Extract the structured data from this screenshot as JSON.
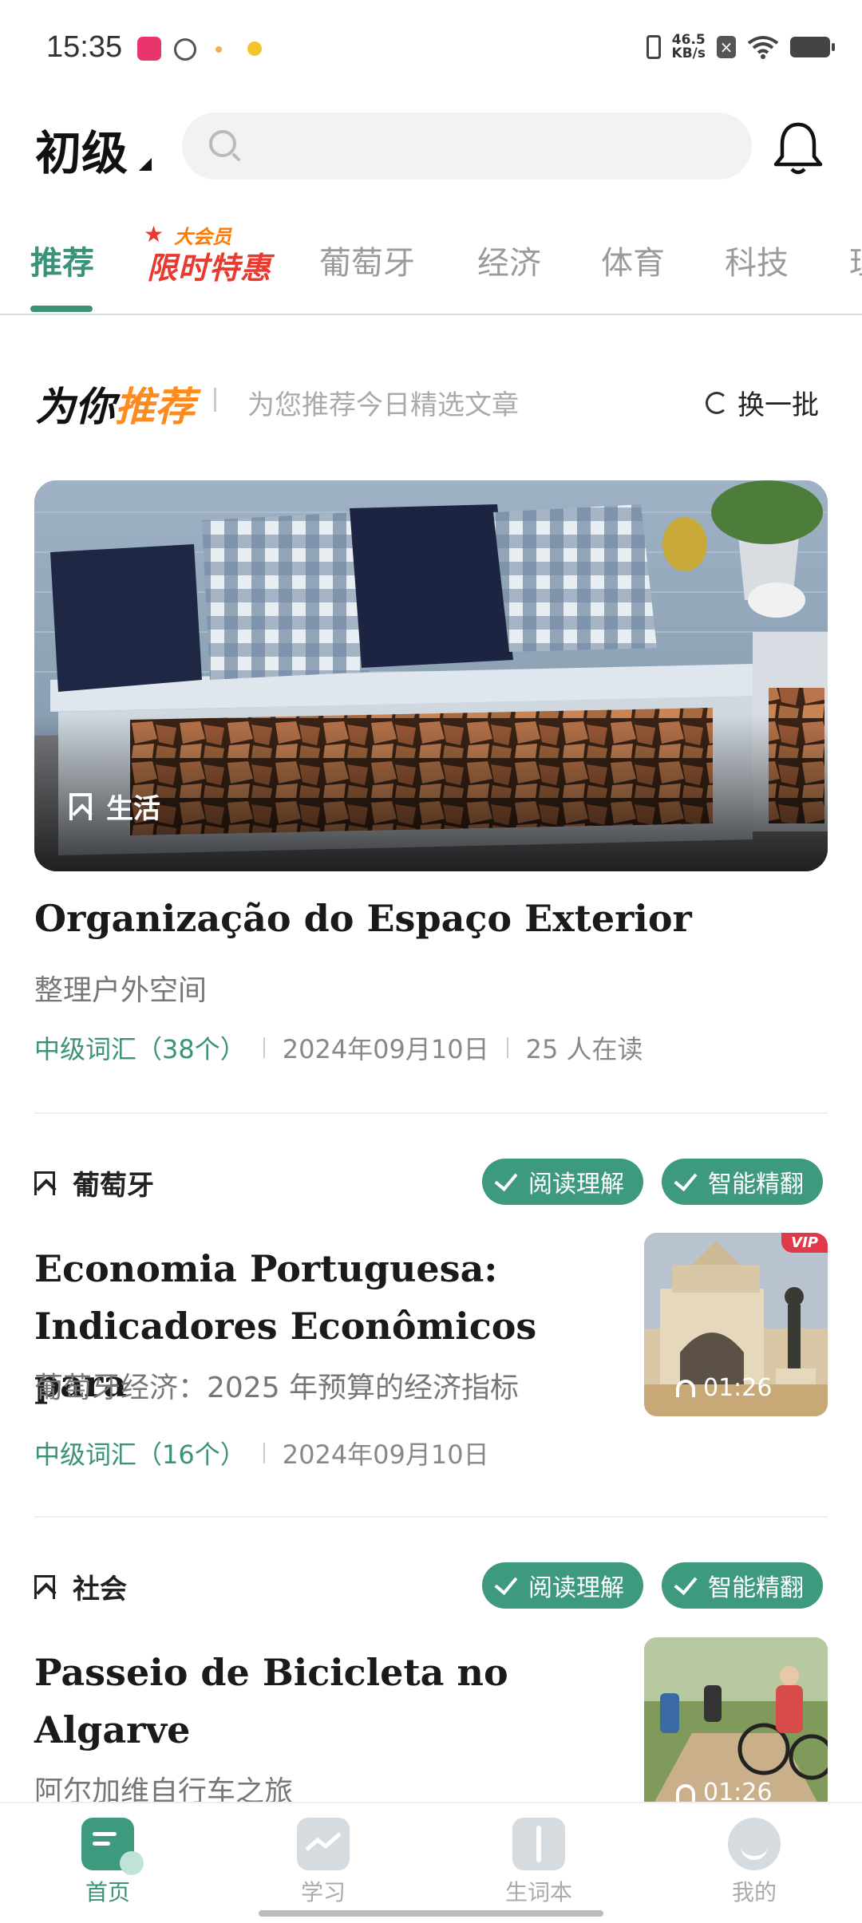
{
  "status_bar": {
    "time": "15:35",
    "net_speed_value": "46.5",
    "net_speed_unit": "KB/s"
  },
  "header": {
    "level": "初级",
    "search_placeholder": "",
    "icons": [
      "search-icon",
      "bell-icon"
    ]
  },
  "tabs": {
    "items": [
      "推荐",
      "葡萄牙",
      "经济",
      "体育",
      "科技",
      "理"
    ],
    "promo_top": "大会员",
    "promo_bottom": "限时特惠",
    "active_color": "#3a9279"
  },
  "section": {
    "title_a": "为你",
    "title_b": "推荐",
    "subtitle": "为您推荐今日精选文章",
    "refresh": "换一批",
    "highlight_color": "#ff8a1e"
  },
  "hero": {
    "category": "生活",
    "title": "Organização do Espaço Exterior",
    "subtitle": "整理户外空间",
    "vocab": "中级词汇（38个）",
    "date": "2024年09月10日",
    "readers": "25 人在读"
  },
  "articles": [
    {
      "category": "葡萄牙",
      "badges": [
        "阅读理解",
        "智能精翻"
      ],
      "title_line1": "Economia Portuguesa:",
      "title_line2": "Indicadores Econômicos para",
      "subtitle": "葡萄牙经济：2025 年预算的经济指标",
      "vocab": "中级词汇（16个）",
      "date": "2024年09月10日",
      "vip": "VIP",
      "duration": "01:26"
    },
    {
      "category": "社会",
      "badges": [
        "阅读理解",
        "智能精翻"
      ],
      "title_line1": "Passeio de Bicicleta no",
      "title_line2": "Algarve",
      "subtitle": "阿尔加维自行车之旅",
      "duration": "01:26"
    }
  ],
  "bottom_nav": {
    "items": [
      "首页",
      "学习",
      "生词本",
      "我的"
    ]
  }
}
